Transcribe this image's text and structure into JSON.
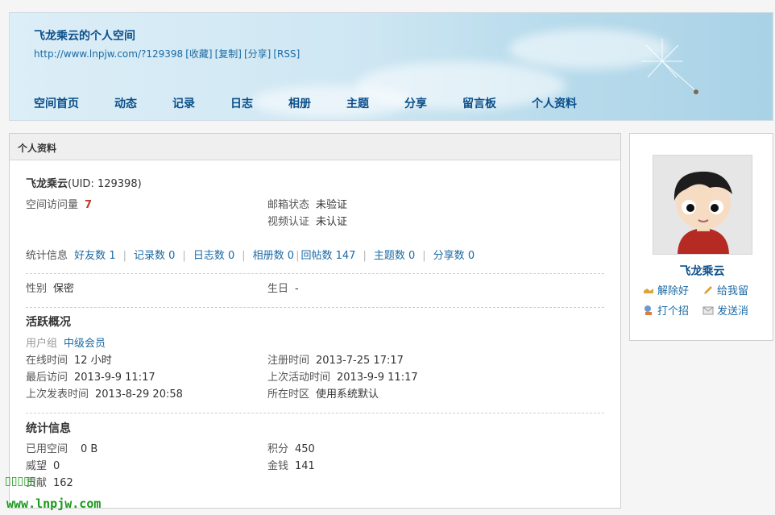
{
  "header": {
    "title": "飞龙乘云的个人空间",
    "url": "http://www.lnpjw.com/?129398",
    "links": [
      "[收藏]",
      "[复制]",
      "[分享]",
      "[RSS]"
    ]
  },
  "nav": [
    "空间首页",
    "动态",
    "记录",
    "日志",
    "相册",
    "主题",
    "分享",
    "留言板",
    "个人资料"
  ],
  "panel": {
    "title": "个人资料",
    "name": "飞龙乘云",
    "uid": "(UID: 129398)",
    "visits_label": "空间访问量",
    "visits_value": "7",
    "email_label": "邮箱状态",
    "email_value": "未验证",
    "video_label": "视频认证",
    "video_value": "未认证",
    "stats_label": "统计信息",
    "stats": [
      {
        "label": "好友数",
        "value": "1"
      },
      {
        "label": "记录数",
        "value": "0"
      },
      {
        "label": "日志数",
        "value": "0"
      },
      {
        "label": "相册数",
        "value": "0"
      },
      {
        "label": "回帖数",
        "value": "147"
      },
      {
        "label": "主题数",
        "value": "0"
      },
      {
        "label": "分享数",
        "value": "0"
      }
    ],
    "gender_label": "性别",
    "gender_value": "保密",
    "birthday_label": "生日",
    "birthday_value": "-",
    "activity_title": "活跃概况",
    "group_label": "用户组",
    "group_value": "中级会员",
    "online_label": "在线时间",
    "online_value": "12 小时",
    "register_label": "注册时间",
    "register_value": "2013-7-25 17:17",
    "last_visit_label": "最后访问",
    "last_visit_value": "2013-9-9 11:17",
    "last_active_label": "上次活动时间",
    "last_active_value": "2013-9-9 11:17",
    "last_post_label": "上次发表时间",
    "last_post_value": "2013-8-29 20:58",
    "timezone_label": "所在时区",
    "timezone_value": "使用系统默认",
    "stats_title": "统计信息",
    "space_label": "已用空间",
    "space_value": "0 B",
    "credits_label": "积分",
    "credits_value": "450",
    "prestige_label": "威望",
    "prestige_value": "0",
    "money_label": "金钱",
    "money_value": "141",
    "contrib_label": "贡献",
    "contrib_value": "162"
  },
  "side": {
    "name": "飞龙乘云",
    "actions": [
      "解除好",
      "给我留",
      "打个招",
      "发送消"
    ]
  },
  "watermark": {
    "line2": "www.lnpjw.com"
  }
}
